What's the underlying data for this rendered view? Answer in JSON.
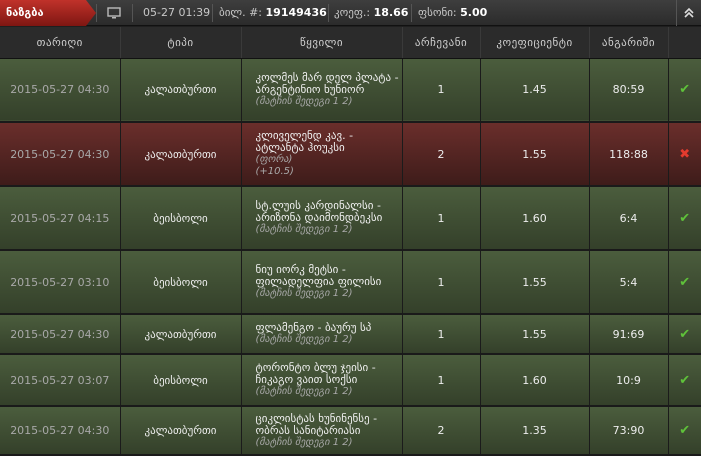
{
  "header": {
    "tag_label": "ნაზგბა",
    "time": "05-27 01:39",
    "ticket_label": "ბილ. #:",
    "ticket_number": "19149436",
    "coef_label": "კოეფ.:",
    "coef_value": "18.66",
    "fund_label": "ფსონი:",
    "fund_value": "5.00",
    "collapse_icon": "double-chevron-up-icon"
  },
  "columns": [
    "თარიღი",
    "ტიპი",
    "წყვილი",
    "არჩევანი",
    "კოეფიციენტი",
    "ანგარიში",
    ""
  ],
  "rows": [
    {
      "result": "win",
      "date": "2015-05-27 04:30",
      "type": "კალათბურთი",
      "event": "კოლმეს მარ დელ პლატა - არგენტინიო ხუნიორ",
      "sub": "(მატჩის შედეგი 1 2)",
      "sub2": "",
      "choice": "1",
      "odds": "1.45",
      "score": "80:59",
      "status": "✔"
    },
    {
      "result": "lose",
      "date": "2015-05-27 04:30",
      "type": "კალათბურთი",
      "event": "კლიველენდ კავ. - ატლანტა ჰოუკსი",
      "sub": "(ფორა)",
      "sub2": "(+10.5)",
      "choice": "2",
      "odds": "1.55",
      "score": "118:88",
      "status": "✖"
    },
    {
      "result": "win",
      "date": "2015-05-27 04:15",
      "type": "ბეისბოლი",
      "event": "სტ.ლუის კარდინალსი - არიზონა დაიმონდბეკსი",
      "sub": "(მატჩის შედეგი 1 2)",
      "sub2": "",
      "choice": "1",
      "odds": "1.60",
      "score": "6:4",
      "status": "✔"
    },
    {
      "result": "win",
      "date": "2015-05-27 03:10",
      "type": "ბეისბოლი",
      "event": "ნიუ იორკ მეტსი - ფილადელფია ფილისი",
      "sub": "(მატჩის შედეგი 1 2)",
      "sub2": "",
      "choice": "1",
      "odds": "1.55",
      "score": "5:4",
      "status": "✔"
    },
    {
      "result": "win",
      "date": "2015-05-27 04:30",
      "type": "კალათბურთი",
      "event": "ფლამენგო - ბაურუ სპ",
      "sub": "(მატჩის შედეგი 1 2)",
      "sub2": "",
      "choice": "1",
      "odds": "1.55",
      "score": "91:69",
      "status": "✔"
    },
    {
      "result": "win",
      "date": "2015-05-27 03:07",
      "type": "ბეისბოლი",
      "event": "ტორონტო ბლუ ჯეისი - ჩიკაგო ვაით სოქსი",
      "sub": "(მატჩის შედეგი 1 2)",
      "sub2": "",
      "choice": "1",
      "odds": "1.60",
      "score": "10:9",
      "status": "✔"
    },
    {
      "result": "win",
      "date": "2015-05-27 04:30",
      "type": "კალათბურთი",
      "event": "ციკლისტას ხუნინენსე - ობრას სანიტარიასი",
      "sub": "(მატჩის შედეგი 1 2)",
      "sub2": "",
      "choice": "2",
      "odds": "1.35",
      "score": "73:90",
      "status": "✔"
    }
  ]
}
